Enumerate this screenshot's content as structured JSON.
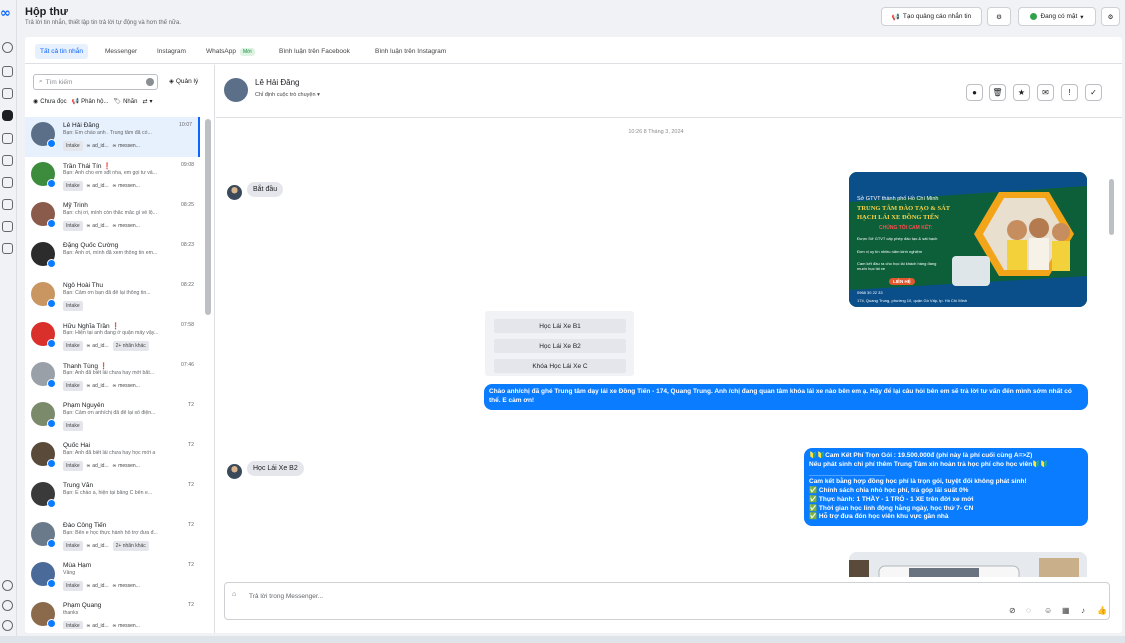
{
  "header": {
    "title": "Hộp thư",
    "subtitle": "Trả lời tin nhắn, thiết lập tin trả lời tự động và hơn thế nữa."
  },
  "topbar": {
    "create_ad": "Tạo quảng cáo nhắn tin",
    "status": "Đang có mặt"
  },
  "tabs": [
    {
      "label": "Tất cả tin nhắn"
    },
    {
      "label": "Messenger"
    },
    {
      "label": "Instagram"
    },
    {
      "label": "WhatsApp",
      "badge": "Mới"
    },
    {
      "label": "Bình luận trên Facebook"
    },
    {
      "label": "Bình luận trên Instagram"
    }
  ],
  "sidebar": {
    "search_placeholder": "Tìm kiếm",
    "manage": "Quản lý",
    "filters": [
      "Chưa đọc",
      "Phân hộ...",
      "Nhãn"
    ],
    "conversations": [
      {
        "name": "Lê Hải Đăng",
        "preview": "Bạn: Em chào anh . Trung tâm đã có...",
        "time": "10:07",
        "tags": [
          "Intake",
          "ad_id...",
          "messen..."
        ],
        "color": "#5b7088"
      },
      {
        "name": "Trần Thái Tín",
        "flag": "❗",
        "preview": "Bạn: Anh cho em sđt nha, em gọi tư vấ...",
        "time": "09:08",
        "tags": [
          "Intake",
          "ad_id...",
          "messen..."
        ],
        "color": "#3d8b3d"
      },
      {
        "name": "Mỹ Trinh",
        "preview": "Bạn: chị ơi, mình còn thắc mắc gì về lộ...",
        "time": "08:25",
        "tags": [
          "Intake",
          "ad_id...",
          "messen..."
        ],
        "color": "#8a5a4a"
      },
      {
        "name": "Đặng Quốc Cường",
        "preview": "Bạn: Anh ơi, mình đã xem thông tin em...",
        "time": "08:23",
        "tags": [],
        "color": "#2c2c2c"
      },
      {
        "name": "Ngô Hoài Thu",
        "preview": "Bạn: Cảm ơn bạn đã để lại thông tin...",
        "time": "08:22",
        "tags": [
          "Intake"
        ],
        "color": "#c99560"
      },
      {
        "name": "Hữu Nghĩa Trần",
        "flag": "❗",
        "preview": "Bạn: Hiện tại anh đang ở quận mấy vậy...",
        "time": "07:58",
        "tags": [
          "Intake",
          "ad_id...",
          "2+ nhãn khác"
        ],
        "color": "#d9302c"
      },
      {
        "name": "Thanh Tùng",
        "flag": "❗",
        "preview": "Bạn: Anh đã biết lái chưa hay mới bắt...",
        "time": "07:46",
        "tags": [
          "Intake",
          "ad_id...",
          "messen..."
        ],
        "color": "#9aa0a8"
      },
      {
        "name": "Phạm Nguyên",
        "preview": "Bạn: Cảm ơn anh/chị đã để lại số điện...",
        "time": "T2",
        "tags": [
          "Intake"
        ],
        "color": "#7a8a6a"
      },
      {
        "name": "Quốc Hai",
        "preview": "Bạn: Anh đã biết lái chưa hay học mới a",
        "time": "T2",
        "tags": [
          "Intake",
          "ad_id...",
          "messen..."
        ],
        "color": "#5a4a3a"
      },
      {
        "name": "Trung Văn",
        "preview": "Bạn: E chào a, hiện tại bằng C bên e...",
        "time": "T2",
        "tags": [],
        "color": "#3a3a3a"
      },
      {
        "name": "Đào Công Tiến",
        "preview": "Bạn: Bên e học thực hành hỗ trợ đưa đ...",
        "time": "T2",
        "tags": [
          "Intake",
          "ad_id...",
          "2+ nhãn khác"
        ],
        "color": "#6a7a8a"
      },
      {
        "name": "Mùa Hạm",
        "preview": "Vâng",
        "time": "T2",
        "tags": [
          "Intake",
          "ad_id...",
          "messen..."
        ],
        "color": "#4a6a9a"
      },
      {
        "name": "Phạm Quang",
        "preview": "thanks",
        "time": "T2",
        "tags": [
          "Intake",
          "ad_id...",
          "messen..."
        ],
        "color": "#8a6a4a"
      }
    ]
  },
  "chat": {
    "name": "Lê Hải Đăng",
    "assign": "Chỉ định cuộc trò chuyện",
    "date": "10:26 8 Tháng 3, 2024",
    "msg_start": "Bắt đầu",
    "poster": {
      "l1": "Sở GTVT thành phố Hồ Chí Minh",
      "l2": "TRUNG TÂM ĐÀO TẠO & SÁT",
      "l3": "HẠCH LÁI XE ĐỒNG TIẾN",
      "l4": "CHÚNG TÔI CAM KẾT:",
      "b1": "Được Sở GTVT cấp phép đào tạo & sát hạch",
      "b2": "Đơn vị uy tín nhiều năm kinh nghiệm",
      "b3": "Cam kết đầu ra cho học lái khách hàng đang muốn học lái xe",
      "cta": "LIÊN HỆ",
      "phone": "0968 30 22 33",
      "addr": "174, Quang Trung, phường 10, quận Gò Vấp, tp. Hồ Chí Minh"
    },
    "quick_replies": [
      "Học Lái Xe B1",
      "Học Lái Xe B2",
      "Khóa Học Lái Xe C"
    ],
    "greeting": "Chào anh/chị đã ghé Trung tâm dạy lái xe Đồng Tiến - 174, Quang Trung. Anh /chị đang quan tâm khóa lái xe nào bên em ạ. Hãy để lại câu hỏi bên em sẽ trả lời tư vấn đến mình sớm nhất có thể. E cảm ơn!",
    "reply_in": "Học Lái Xe B2",
    "offer": [
      "🔰🔰Cam Kết Phí Trọn Gói : 19.500.000đ (phí này là phí cuối cùng A=>Z)",
      "Nếu phát sinh chi phí thêm Trung Tâm xin hoàn trả học phí cho học viên🔰🔰",
      "_____________________",
      "Cam kết bằng hợp đồng học phí là trọn gói, tuyệt đối không phát sinh!",
      "✅ Chính sách chia nhỏ học phí, trả góp lãi suất 0%",
      "✅ Thực hành: 1 THẦY - 1 TRÒ - 1 XE trên đời xe mới",
      "✅ Thời gian học linh động hằng ngày, học thứ 7- CN",
      "✅ Hỗ trợ đưa đón học viên khu vực gần nhà"
    ],
    "reply_placeholder": "Trả lời trong Messenger..."
  },
  "colors": {
    "accent": "#0a7cff",
    "selected_bg": "#e7f0fd"
  }
}
